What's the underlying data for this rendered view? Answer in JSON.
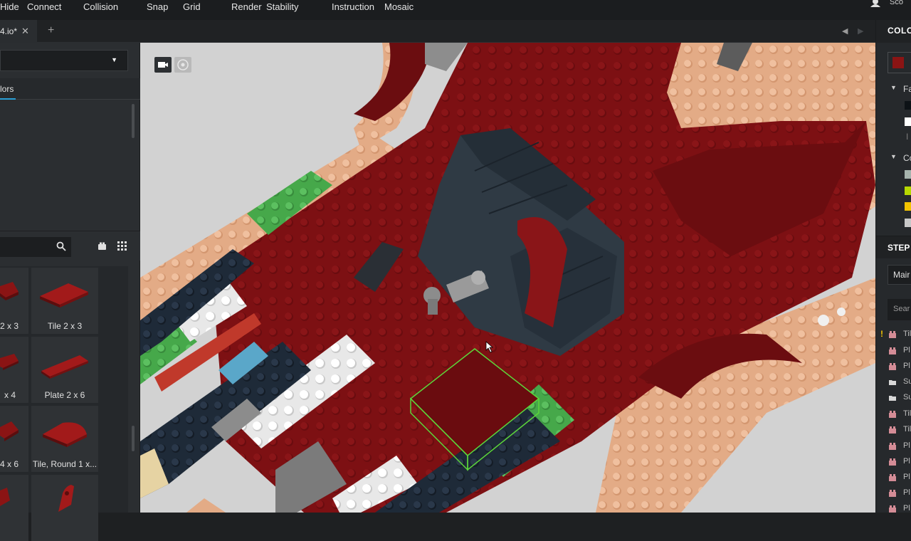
{
  "menu": [
    "Hide",
    "Connect",
    "Collision",
    "Snap",
    "Grid",
    "Render",
    "Stability",
    "Instruction",
    "Mosaic"
  ],
  "user": {
    "name": "Sco"
  },
  "tab": {
    "label": "4.io*",
    "close": "✕",
    "add": "+"
  },
  "nav": {
    "back": "◀",
    "forward": "▶"
  },
  "left_panel": {
    "dropdown_caret": "▼",
    "colors_tab": "lors",
    "bricks": [
      {
        "label": "2 x 3",
        "color": "#8b1414"
      },
      {
        "label": "Tile 2 x 3",
        "color": "#8b1414"
      },
      {
        "label": "x 4",
        "color": "#8b1414"
      },
      {
        "label": "Plate 2 x 6",
        "color": "#8b1414"
      },
      {
        "label": "4 x 6",
        "color": "#8b1414"
      },
      {
        "label": "Tile, Round 1 x...",
        "color": "#8b1414"
      },
      {
        "label": "",
        "color": "#8b1414"
      },
      {
        "label": "",
        "color": "#8b1414"
      }
    ]
  },
  "right_panel": {
    "title": "COLO",
    "current_color": "#8b1414",
    "group1": {
      "label": "Fa",
      "swatches": [
        "#0d1216",
        "#ffffff"
      ],
      "extra": "I"
    },
    "group2": {
      "label": "Co",
      "swatches": [
        "#a6b3ad",
        "#b7d800",
        "#f3c300",
        "#c8c8c8"
      ]
    },
    "step_title": "STEP",
    "main_label": "Mair",
    "search_placeholder": "Sear",
    "steps": [
      {
        "label": "Til",
        "type": "brick",
        "warn": "!"
      },
      {
        "label": "Pl",
        "type": "brick"
      },
      {
        "label": "Pl",
        "type": "brick"
      },
      {
        "label": "Su",
        "type": "folder"
      },
      {
        "label": "Su",
        "type": "folder"
      },
      {
        "label": "Til",
        "type": "brick"
      },
      {
        "label": "Til",
        "type": "brick"
      },
      {
        "label": "Pl",
        "type": "brick"
      },
      {
        "label": "Pl",
        "type": "brick"
      },
      {
        "label": "Pl",
        "type": "brick"
      },
      {
        "label": "Pl",
        "type": "brick"
      },
      {
        "label": "Pl",
        "type": "brick"
      }
    ]
  },
  "colors": {
    "dark_red": "#7d1013",
    "tan": "#e3ab86",
    "green": "#46a84a",
    "white": "#f2f2f2",
    "dark_blue": "#1e2a38",
    "dark_gray": "#2f3a44",
    "light_gray": "#a9a9a9",
    "selection": "#5cd63a"
  }
}
